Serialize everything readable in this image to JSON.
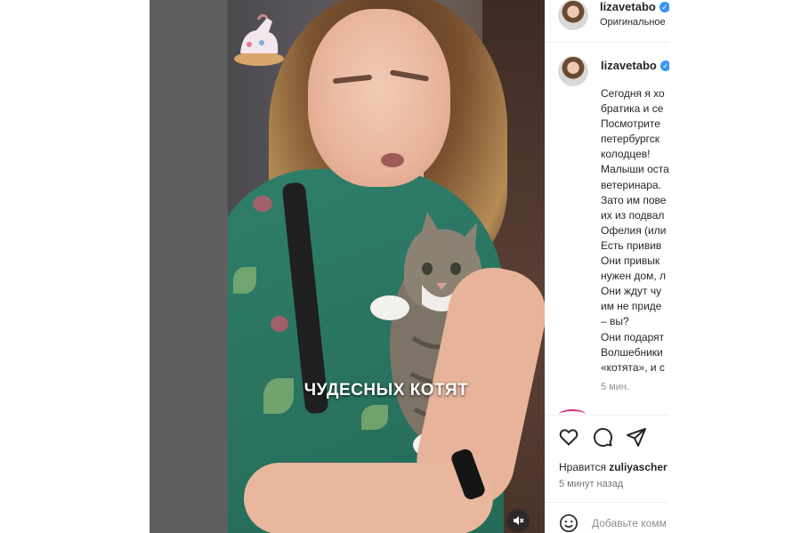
{
  "post": {
    "author": "lizavetabo",
    "header_subtitle": "Оригинальное",
    "video_caption": "ЧУДЕСНЫХ КОТЯТ",
    "caption_lines": [
      "Сегодня я хо",
      "братика и се",
      "Посмотрите",
      "петербургск",
      "колодцев!",
      "Малыши оста",
      "ветеринара.",
      "Зато им пове",
      "их из подвал",
      "Офелия (или",
      "Есть привив",
      "Они привык",
      "нужен дом, л",
      "Они ждут чу",
      "им не приде",
      "– вы?",
      "Они подарят",
      "Волшебники",
      "«котята», и с"
    ],
    "caption_time": "5 мин.",
    "likes_prefix": "Нравится",
    "likes_user": "zuliyascher",
    "posted_ago": "5 минут назад",
    "comment_placeholder": "Добавьте комм"
  },
  "icons": {
    "verified": "verified-badge-icon",
    "like": "heart-icon",
    "comment": "comment-icon",
    "share": "send-icon",
    "mute": "muted-speaker-icon",
    "emoji": "emoji-icon"
  },
  "colors": {
    "verified_blue": "#3797f0",
    "text": "#262626",
    "muted_text": "#8e8e8e"
  }
}
